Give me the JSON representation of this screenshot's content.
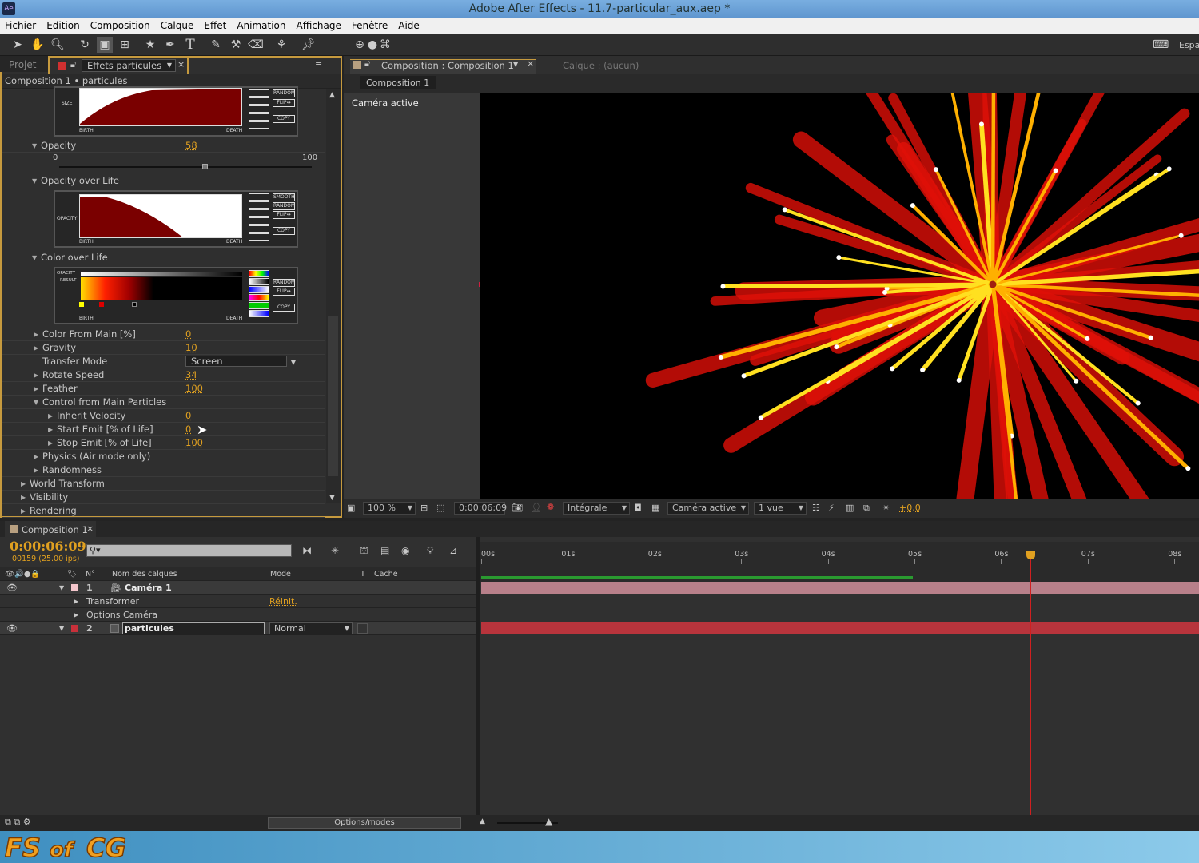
{
  "window": {
    "app_icon": "Ae",
    "title": "Adobe After Effects - 11.7-particular_aux.aep *"
  },
  "menu": [
    "Fichier",
    "Edition",
    "Composition",
    "Calque",
    "Effet",
    "Animation",
    "Affichage",
    "Fenêtre",
    "Aide"
  ],
  "toolbar": {
    "workspace_label": "Espa",
    "tools": [
      "selection-tool",
      "hand-tool",
      "zoom-tool",
      "rotate-tool",
      "camera-orbit-tool",
      "pan-behind-tool",
      "star-shape-tool",
      "pen-tool",
      "text-tool",
      "brush-tool",
      "clone-stamp-tool",
      "eraser-tool",
      "roto-brush-tool",
      "puppet-pin-tool"
    ]
  },
  "left_panel": {
    "tabs": {
      "project": "Projet",
      "effects": "Effets particules"
    },
    "breadcrumb": "Composition 1 • particules",
    "size_graph": {
      "axis": "SIZE",
      "birth": "BIRTH",
      "death": "DEATH",
      "buttons": [
        "RANDOM",
        "FLIP↔",
        "COPY"
      ]
    },
    "opacity": {
      "label": "Opacity",
      "value": "58",
      "min": "0",
      "max": "100",
      "slider_fraction": 0.58
    },
    "opacity_over_life": {
      "label": "Opacity over Life",
      "axis": "OPACITY",
      "birth": "BIRTH",
      "death": "DEATH",
      "buttons": [
        "SMOOTH",
        "RANDOM",
        "FLIP↔",
        "COPY"
      ]
    },
    "color_over_life": {
      "label": "Color over Life",
      "opacity_lbl": "OPACITY",
      "result_lbl": "RESULT",
      "birth": "BIRTH",
      "death": "DEATH",
      "buttons": [
        "RANDOM",
        "FLIP↔",
        "COPY"
      ]
    },
    "params": [
      {
        "label": "Color From Main [%]",
        "value": "0"
      },
      {
        "label": "Gravity",
        "value": "10"
      },
      {
        "label": "Transfer Mode",
        "value": "Screen"
      },
      {
        "label": "Rotate Speed",
        "value": "34"
      },
      {
        "label": "Feather",
        "value": "100"
      },
      {
        "label": "Control from Main Particles",
        "value": ""
      },
      {
        "label": "Inherit Velocity",
        "value": "0"
      },
      {
        "label": "Start Emit [% of Life]",
        "value": "0"
      },
      {
        "label": "Stop Emit [% of Life]",
        "value": "100"
      },
      {
        "label": "Physics (Air mode only)",
        "value": ""
      },
      {
        "label": "Randomness",
        "value": ""
      },
      {
        "label": "World Transform",
        "value": ""
      },
      {
        "label": "Visibility",
        "value": ""
      },
      {
        "label": "Rendering",
        "value": ""
      }
    ]
  },
  "viewer": {
    "tab": "Composition : Composition 1",
    "layer_tab": "Calque : (aucun)",
    "comp_chip": "Composition 1",
    "camera_label": "Caméra active",
    "bar": {
      "zoom": "100 %",
      "timecode": "0:00:06:09",
      "resolution": "Intégrale",
      "camera": "Caméra active",
      "views": "1 vue",
      "exposure": "+0,0"
    }
  },
  "timeline": {
    "tab": "Composition 1",
    "timecode": "0:00:06:09",
    "frame_info": "00159 (25.00 ips)",
    "columns": {
      "num": "N°",
      "name": "Nom des calques",
      "mode": "Mode",
      "t": "T",
      "matte": "Cache"
    },
    "layers": [
      {
        "num": "1",
        "name": "Caméra 1",
        "color": "#f4c6cc",
        "children": [
          {
            "label": "Transformer",
            "action": "Réinit."
          },
          {
            "label": "Options Caméra"
          }
        ]
      },
      {
        "num": "2",
        "name": "particules",
        "mode": "Normal",
        "color": "#c8303a"
      }
    ],
    "ruler": [
      "00s",
      "01s",
      "02s",
      "03s",
      "04s",
      "05s",
      "06s",
      "07s",
      "08s"
    ],
    "playhead_seconds": 6.36,
    "bottom_button": "Options/modes"
  },
  "watermark": "FS of CG",
  "colors": {
    "accent": "#e0a020",
    "panel_border": "#c69a3e",
    "playhead": "#d02020",
    "layer_bar_camera": "#b8808a",
    "layer_bar_particles": "#b8343c"
  }
}
